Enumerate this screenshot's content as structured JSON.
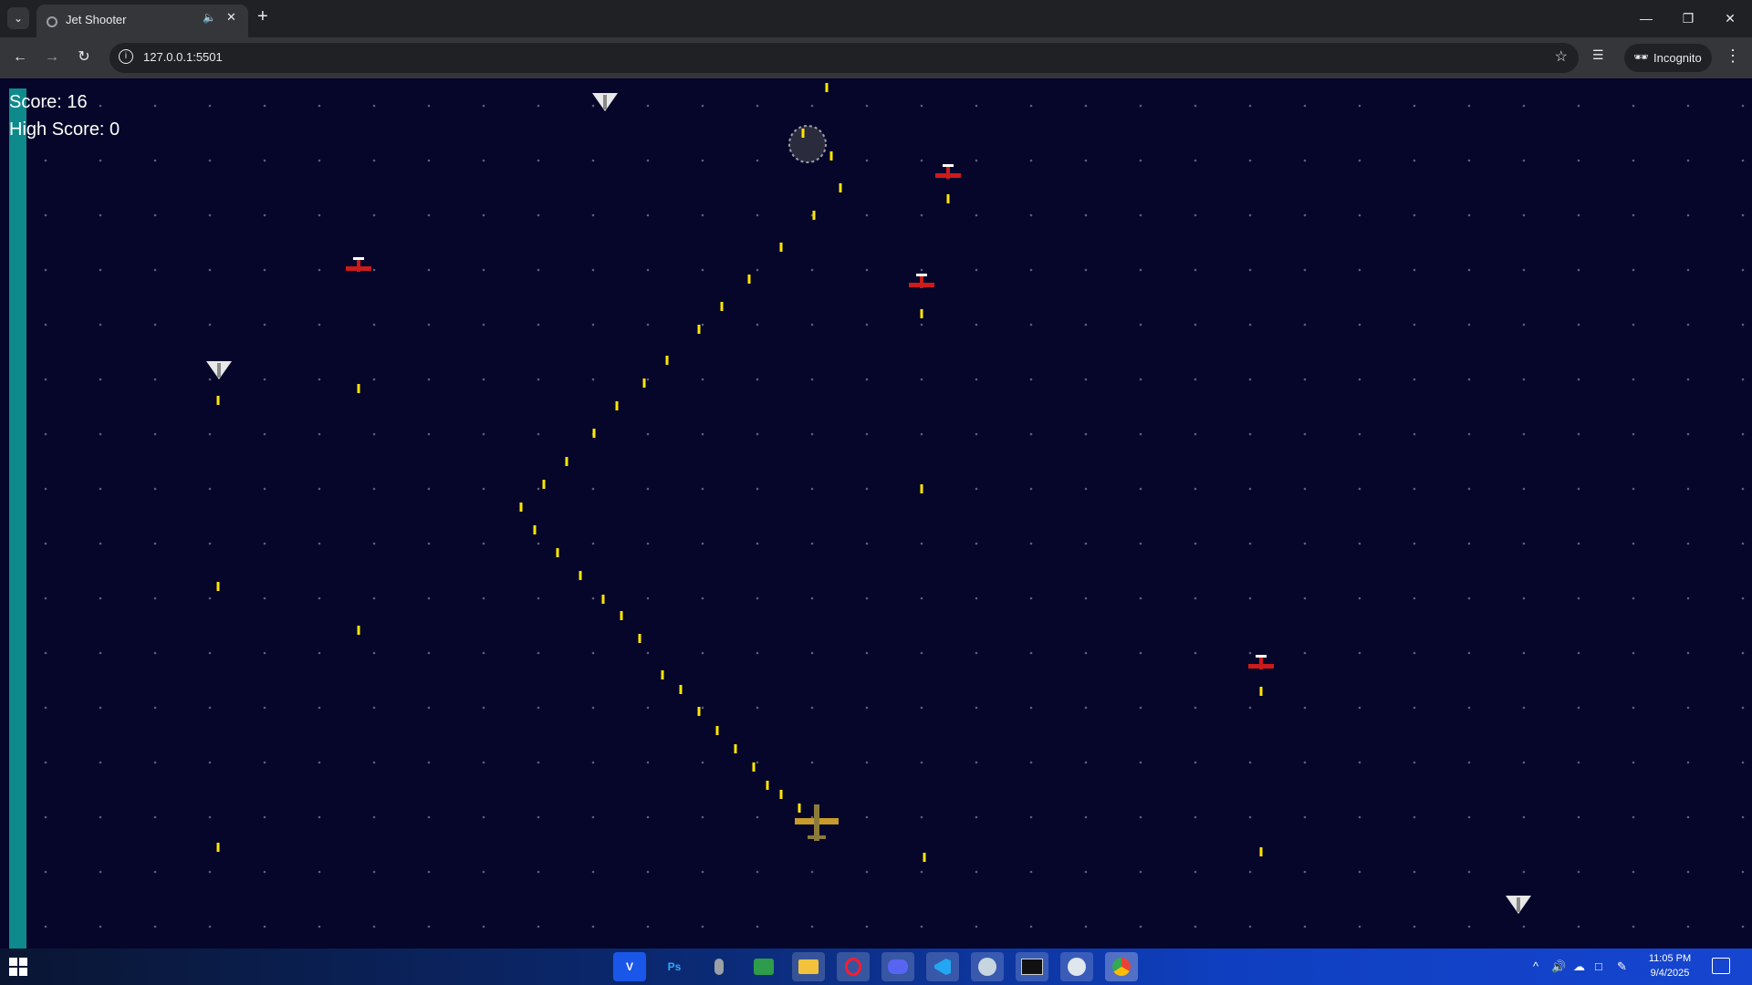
{
  "browser": {
    "tab_title": "Jet Shooter",
    "tab_audio_icon": "speaker-icon",
    "tab_close_icon": "close-icon",
    "new_tab_icon": "plus-icon",
    "url": "127.0.0.1:5501",
    "incognito_label": "Incognito"
  },
  "game": {
    "score_text": "Score: 16",
    "high_score_text": "High Score: 0",
    "background_color": "#05062a",
    "health_bar_color": "#0e8a8c",
    "bullet_color": "#ffe600",
    "red_plane_color": "#cc1b1b",
    "white_jet_color": "#e8e8e8",
    "player_plane_color": "#c89a2a"
  },
  "taskbar": {
    "apps": [
      "V",
      "Ps",
      "",
      "",
      "",
      "",
      "",
      "",
      "",
      "",
      "",
      ""
    ],
    "time": "11:05 PM",
    "date": "9/4/2025"
  }
}
